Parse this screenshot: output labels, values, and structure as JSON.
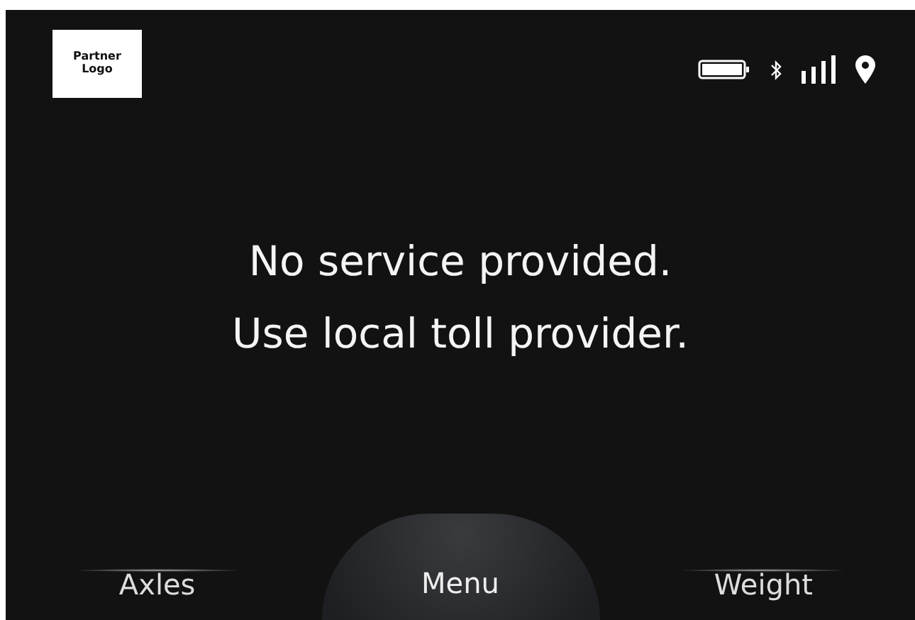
{
  "logo": {
    "text": "Partner Logo"
  },
  "message": [
    "No service provided.",
    "Use local toll provider."
  ],
  "buttons": [
    {
      "label": "Axles",
      "kind": "side"
    },
    {
      "label": "Menu",
      "kind": "center"
    },
    {
      "label": "Weight",
      "kind": "side"
    }
  ]
}
